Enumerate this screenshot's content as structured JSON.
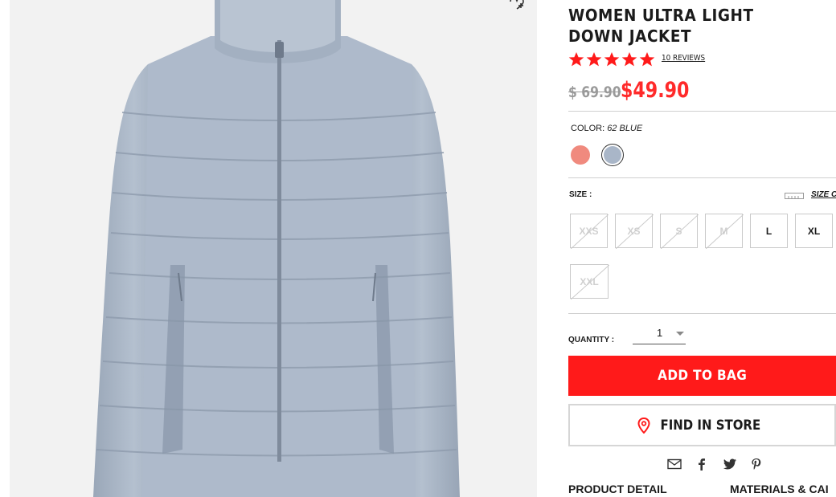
{
  "product": {
    "title": "WOMEN ULTRA LIGHT DOWN JACKET",
    "rating_stars": 5,
    "reviews_link": "10 REVIEWS",
    "original_price": "$ 69.90",
    "sale_price": "$49.90"
  },
  "color": {
    "label": "COLOR:",
    "selected": "62 BLUE",
    "swatches": [
      {
        "name": "coral",
        "hex": "#f08a7e",
        "selected": false
      },
      {
        "name": "62 BLUE",
        "hex": "#a9b6c8",
        "selected": true
      }
    ]
  },
  "size": {
    "label": "SIZE :",
    "guide_link": "SIZE C",
    "options": [
      {
        "label": "XXS",
        "available": false
      },
      {
        "label": "XS",
        "available": false
      },
      {
        "label": "S",
        "available": false
      },
      {
        "label": "M",
        "available": false
      },
      {
        "label": "L",
        "available": true
      },
      {
        "label": "XL",
        "available": true
      },
      {
        "label": "XXL",
        "available": false
      }
    ]
  },
  "quantity": {
    "label": "QUANTITY :",
    "value": "1"
  },
  "buttons": {
    "add_to_bag": "ADD TO BAG",
    "find_in_store": "FIND IN STORE"
  },
  "share_icons": [
    "email-icon",
    "facebook-icon",
    "twitter-icon",
    "pinterest-icon"
  ],
  "tabs": [
    "PRODUCT DETAIL",
    "MATERIALS & CAI"
  ],
  "colors": {
    "accent": "#ff1a1a",
    "star": "#ff1a1a",
    "jacket": "#a9b6c8"
  }
}
